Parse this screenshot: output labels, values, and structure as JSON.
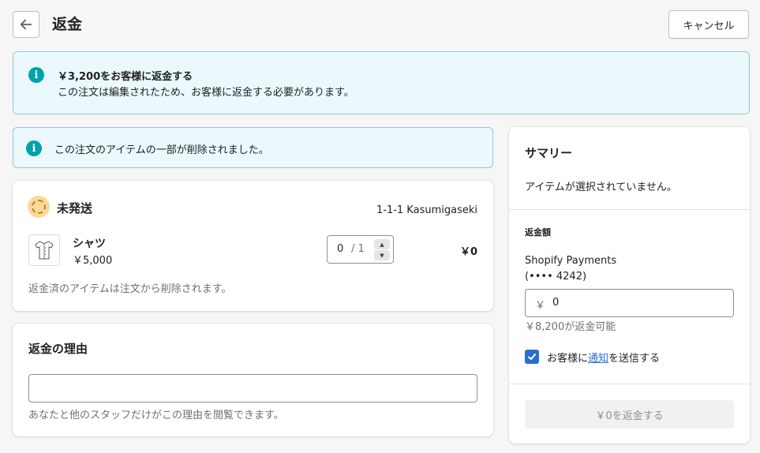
{
  "header": {
    "title": "返金",
    "back_icon": "arrow-left-icon",
    "cancel_label": "キャンセル"
  },
  "banner_top": {
    "icon": "info-icon",
    "icon_glyph": "i",
    "title": "￥3,200をお客様に返金する",
    "body": "この注文は編集されたため、お客様に返金する必要があります。"
  },
  "banner_removed": {
    "icon": "info-icon",
    "icon_glyph": "i",
    "text": "この注文のアイテムの一部が削除されました。"
  },
  "fulfillment": {
    "status_label": "未発送",
    "address": "1-1-1 Kasumigaseki",
    "items": [
      {
        "name": "シャツ",
        "price": "￥5,000",
        "quantity": "0",
        "quantity_max": "/ 1",
        "line_total": "￥0"
      }
    ],
    "note": "返金済のアイテムは注文から削除されます。"
  },
  "reason": {
    "title": "返金の理由",
    "value": "",
    "help": "あなたと他のスタッフだけがこの理由を閲覧できます。"
  },
  "summary": {
    "title": "サマリー",
    "empty_text": "アイテムが選択されていません。",
    "refund_heading": "返金額",
    "gateway": "Shopify Payments",
    "card": "(•••• 4242)",
    "amount_prefix": "￥",
    "amount_value": "0",
    "available": "￥8,200が返金可能",
    "notify_pre": "お客様に",
    "notify_link": "通知",
    "notify_post": "を送信する",
    "notify_checked": true,
    "refund_button": "￥0を返金する"
  },
  "colors": {
    "background": "#f6f6f7",
    "info_banner": "#ebf9fc",
    "info_icon": "#00a0ac",
    "link": "#2c6ecb",
    "status_badge": "#ffd79d"
  }
}
